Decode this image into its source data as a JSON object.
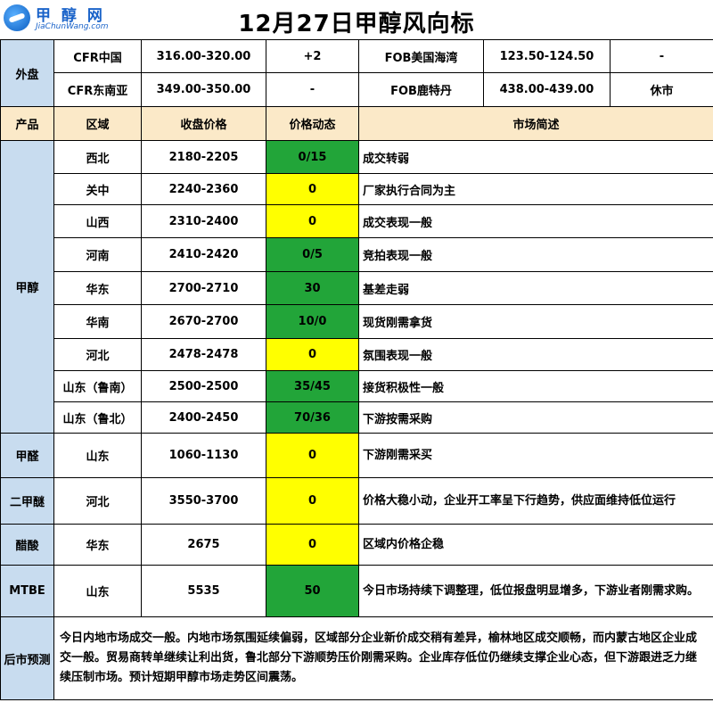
{
  "header": {
    "title": "12月27日甲醇风向标",
    "logo_cn": "甲 醇 网",
    "logo_en": "JiaChunWang.com"
  },
  "external": {
    "label": "外盘",
    "rows": [
      {
        "name1": "CFR中国",
        "price1": "316.00-320.00",
        "chg1": "+2",
        "name2": "FOB美国海湾",
        "price2": "123.50-124.50",
        "chg2": "-"
      },
      {
        "name1": "CFR东南亚",
        "price1": "349.00-350.00",
        "chg1": "-",
        "name2": "FOB鹿特丹",
        "price2": "438.00-439.00",
        "chg2": "休市"
      }
    ]
  },
  "columns": {
    "product": "产品",
    "region": "区域",
    "price": "收盘价格",
    "change": "价格动态",
    "desc": "市场简述"
  },
  "methanol": {
    "label": "甲醇",
    "rows": [
      {
        "region": "西北",
        "price": "2180-2205",
        "change": "0/15",
        "color": "#22a539",
        "desc": "成交转弱"
      },
      {
        "region": "关中",
        "price": "2240-2360",
        "change": "0",
        "color": "#ffff00",
        "desc": "厂家执行合同为主"
      },
      {
        "region": "山西",
        "price": "2310-2400",
        "change": "0",
        "color": "#ffff00",
        "desc": "成交表现一般"
      },
      {
        "region": "河南",
        "price": "2410-2420",
        "change": "0/5",
        "color": "#22a539",
        "desc": "竞拍表现一般"
      },
      {
        "region": "华东",
        "price": "2700-2710",
        "change": "30",
        "color": "#22a539",
        "desc": "基差走弱"
      },
      {
        "region": "华南",
        "price": "2670-2700",
        "change": "10/0",
        "color": "#22a539",
        "desc": "现货刚需拿货"
      },
      {
        "region": "河北",
        "price": "2478-2478",
        "change": "0",
        "color": "#ffff00",
        "desc": "氛围表现一般"
      },
      {
        "region": "山东（鲁南）",
        "price": "2500-2500",
        "change": "35/45",
        "color": "#22a539",
        "desc": "接货积极性一般"
      },
      {
        "region": "山东（鲁北）",
        "price": "2400-2450",
        "change": "70/36",
        "color": "#22a539",
        "desc": "下游按需采购"
      }
    ]
  },
  "others": [
    {
      "product": "甲醛",
      "region": "山东",
      "price": "1060-1130",
      "change": "0",
      "color": "#ffff00",
      "desc": "下游刚需采买"
    },
    {
      "product": "二甲醚",
      "region": "河北",
      "price": "3550-3700",
      "change": "0",
      "color": "#ffff00",
      "desc": "价格大稳小动，企业开工率呈下行趋势，供应面维持低位运行"
    },
    {
      "product": "醋酸",
      "region": "华东",
      "price": "2675",
      "change": "0",
      "color": "#ffff00",
      "desc": "区域内价格企稳"
    },
    {
      "product": "MTBE",
      "region": "山东",
      "price": "5535",
      "change": "50",
      "color": "#22a539",
      "desc": "今日市场持续下调整理，低位报盘明显增多，下游业者刚需求购。"
    }
  ],
  "forecast": {
    "label": "后市预测",
    "text": "今日内地市场成交一般。内地市场氛围延续偏弱，区域部分企业新价成交稍有差异，榆林地区成交顺畅，而内蒙古地区企业成交一般。贸易商转单继续让利出货，鲁北部分下游顺势压价刚需采购。企业库存低位仍继续支撑企业心态，但下游跟进乏力继续压制市场。预计短期甲醇市场走势区间震荡。"
  }
}
